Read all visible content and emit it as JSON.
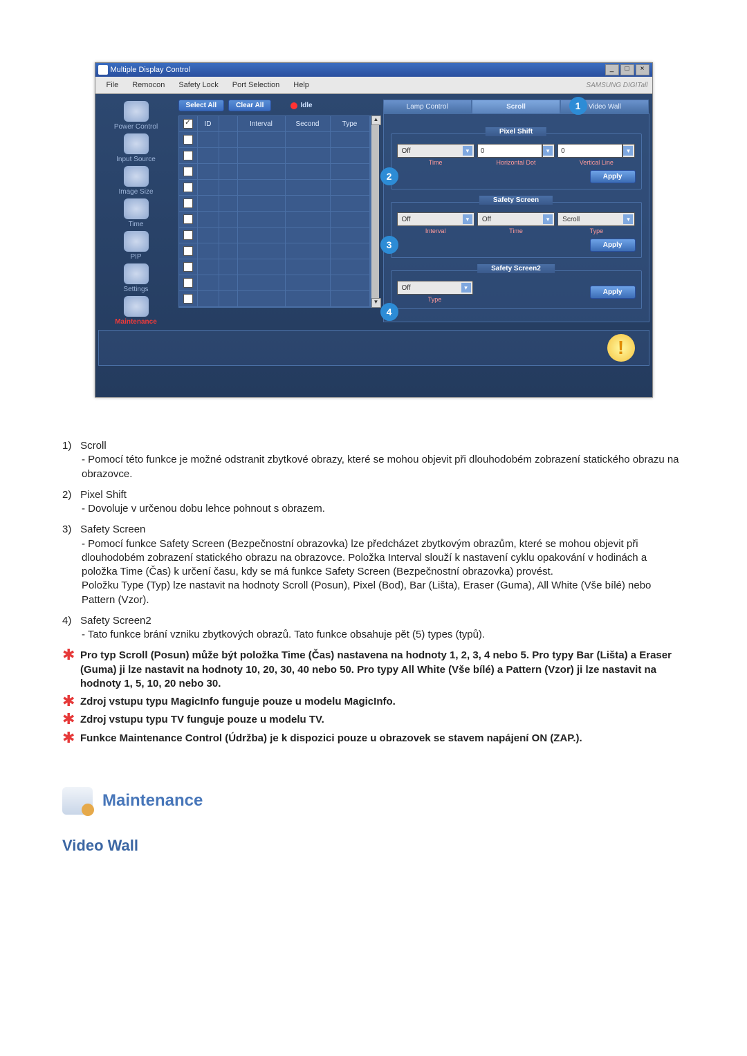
{
  "window": {
    "title": "Multiple Display Control",
    "menu": [
      "File",
      "Remocon",
      "Safety Lock",
      "Port Selection",
      "Help"
    ],
    "brand": "SAMSUNG DIGITall"
  },
  "sidebar": {
    "items": [
      {
        "label": "Power Control"
      },
      {
        "label": "Input Source"
      },
      {
        "label": "Image Size"
      },
      {
        "label": "Time"
      },
      {
        "label": "PIP"
      },
      {
        "label": "Settings"
      },
      {
        "label": "Maintenance"
      }
    ]
  },
  "toolbar": {
    "select_all": "Select All",
    "clear_all": "Clear All",
    "idle": "Idle"
  },
  "grid": {
    "headers": [
      "",
      "ID",
      "",
      "Interval",
      "Second",
      "Type"
    ]
  },
  "tabs": {
    "items": [
      "Lamp Control",
      "Scroll",
      "Video Wall"
    ],
    "active": 1
  },
  "pixel_shift": {
    "legend": "Pixel Shift",
    "time_val": "Off",
    "time_label": "Time",
    "hdot_val": "0",
    "hdot_label": "Horizontal Dot",
    "vline_val": "0",
    "vline_label": "Vertical Line",
    "apply": "Apply"
  },
  "safety_screen": {
    "legend": "Safety Screen",
    "interval_val": "Off",
    "interval_label": "Interval",
    "time_val": "Off",
    "time_label": "Time",
    "type_val": "Scroll",
    "type_label": "Type",
    "apply": "Apply"
  },
  "safety_screen2": {
    "legend": "Safety Screen2",
    "type_val": "Off",
    "type_label": "Type",
    "apply": "Apply"
  },
  "callouts": {
    "c1": "1",
    "c2": "2",
    "c3": "3",
    "c4": "4"
  },
  "doc": {
    "items": [
      {
        "num": "1)",
        "title": "Scroll",
        "desc": "- Pomocí této funkce je možné odstranit zbytkové obrazy, které se mohou objevit při dlouhodobém zobrazení statického obrazu na obrazovce."
      },
      {
        "num": "2)",
        "title": "Pixel Shift",
        "desc": "- Dovoluje v určenou dobu lehce pohnout s obrazem."
      },
      {
        "num": "3)",
        "title": "Safety Screen",
        "desc": "- Pomocí funkce Safety Screen (Bezpečnostní obrazovka) lze předcházet zbytkovým obrazům, které se mohou objevit při dlouhodobém zobrazení statického obrazu na obrazovce.  Položka Interval slouží k nastavení cyklu opakování v hodinách a položka Time (Čas) k určení času, kdy se má funkce Safety Screen (Bezpečnostní obrazovka) provést.",
        "desc2": "Položku Type (Typ) lze nastavit na hodnoty Scroll (Posun), Pixel (Bod), Bar (Lišta), Eraser (Guma), All White (Vše bílé) nebo Pattern (Vzor)."
      },
      {
        "num": "4)",
        "title": "Safety Screen2",
        "desc": "- Tato funkce brání vzniku zbytkových obrazů. Tato funkce obsahuje pět (5) types (typů)."
      }
    ],
    "notes": [
      "Pro typ Scroll (Posun) může být položka Time (Čas) nastavena na hodnoty 1, 2, 3, 4 nebo 5. Pro typy Bar (Lišta) a Eraser (Guma) ji lze nastavit na hodnoty 10, 20, 30, 40 nebo 50. Pro typy All White (Vše bílé) a Pattern (Vzor) ji lze nastavit na hodnoty 1, 5, 10, 20 nebo 30.",
      "Zdroj vstupu typu MagicInfo funguje pouze u modelu MagicInfo.",
      "Zdroj vstupu typu TV funguje pouze u modelu TV.",
      "Funkce Maintenance Control (Údržba) je k dispozici pouze u obrazovek se stavem napájení ON (ZAP.)."
    ],
    "section_title": "Maintenance",
    "subsection_title": "Video Wall"
  }
}
